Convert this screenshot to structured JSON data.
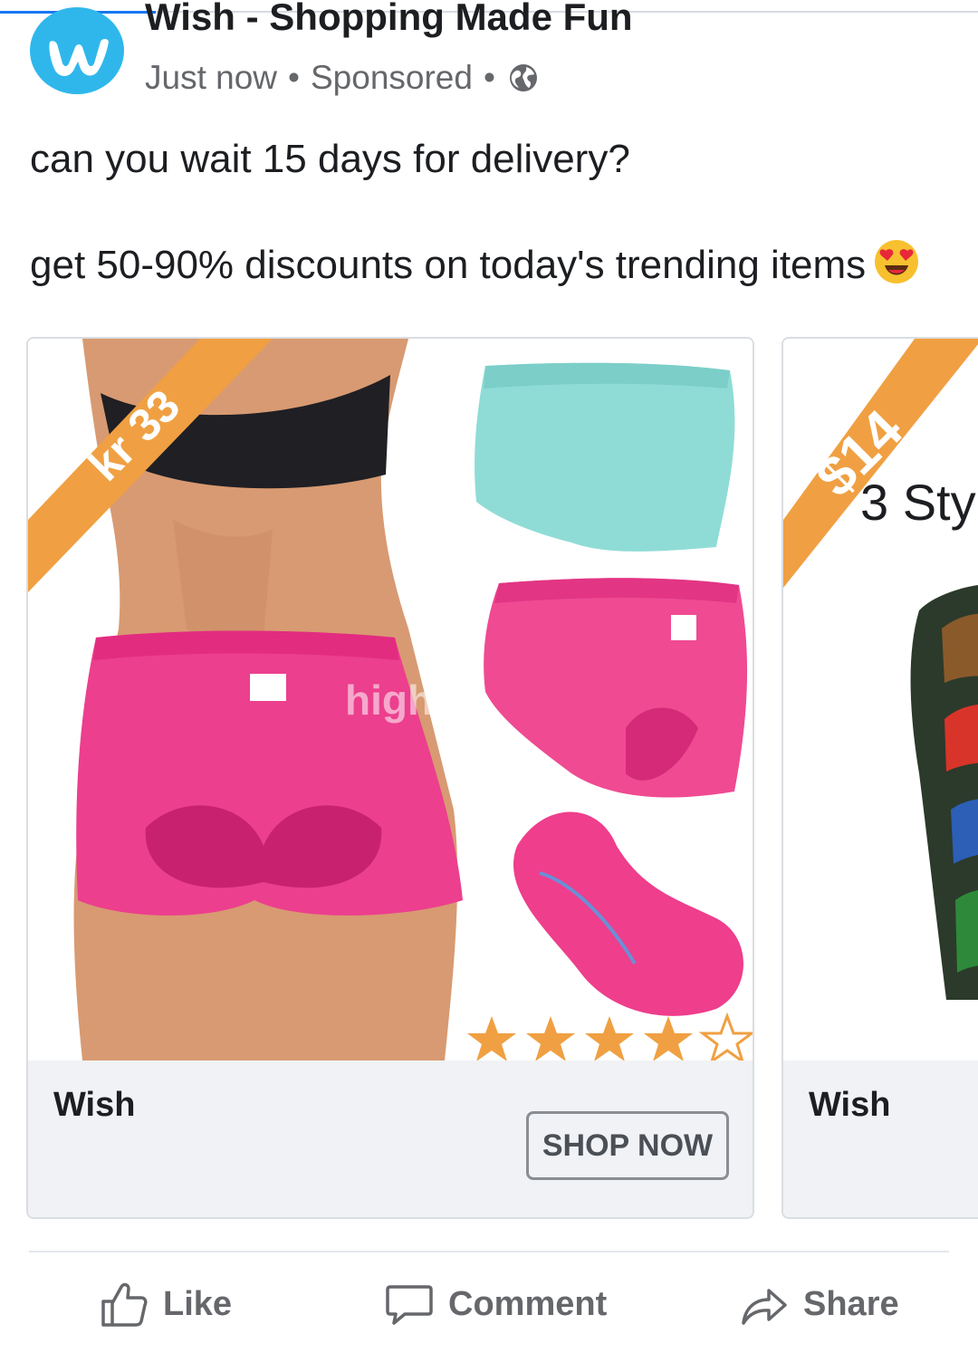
{
  "post": {
    "page_name": "Wish - Shopping Made Fun",
    "time": "Just now",
    "sponsored": "Sponsored",
    "separator": "•",
    "text_line1": "can you wait 15 days for delivery?",
    "text_line2": "get 50-90% discounts on today's trending items",
    "avatar_icon": "wish-logo-icon",
    "privacy_icon": "globe-icon",
    "emoji_icon": "heart-eyes-emoji-icon"
  },
  "carousel": {
    "cards": [
      {
        "price": "kr 33",
        "watermark": "high",
        "title": "Wish",
        "cta": "SHOP NOW",
        "rating": 4
      },
      {
        "price": "$14",
        "overlay_text": "3 Sty",
        "title": "Wish"
      }
    ]
  },
  "actions": {
    "like": "Like",
    "comment": "Comment",
    "share": "Share"
  },
  "colors": {
    "brand_blue": "#2fb7ec",
    "price_banner": "#f0a042",
    "facebook_blue": "#1877f2",
    "muted_text": "#65676b"
  }
}
